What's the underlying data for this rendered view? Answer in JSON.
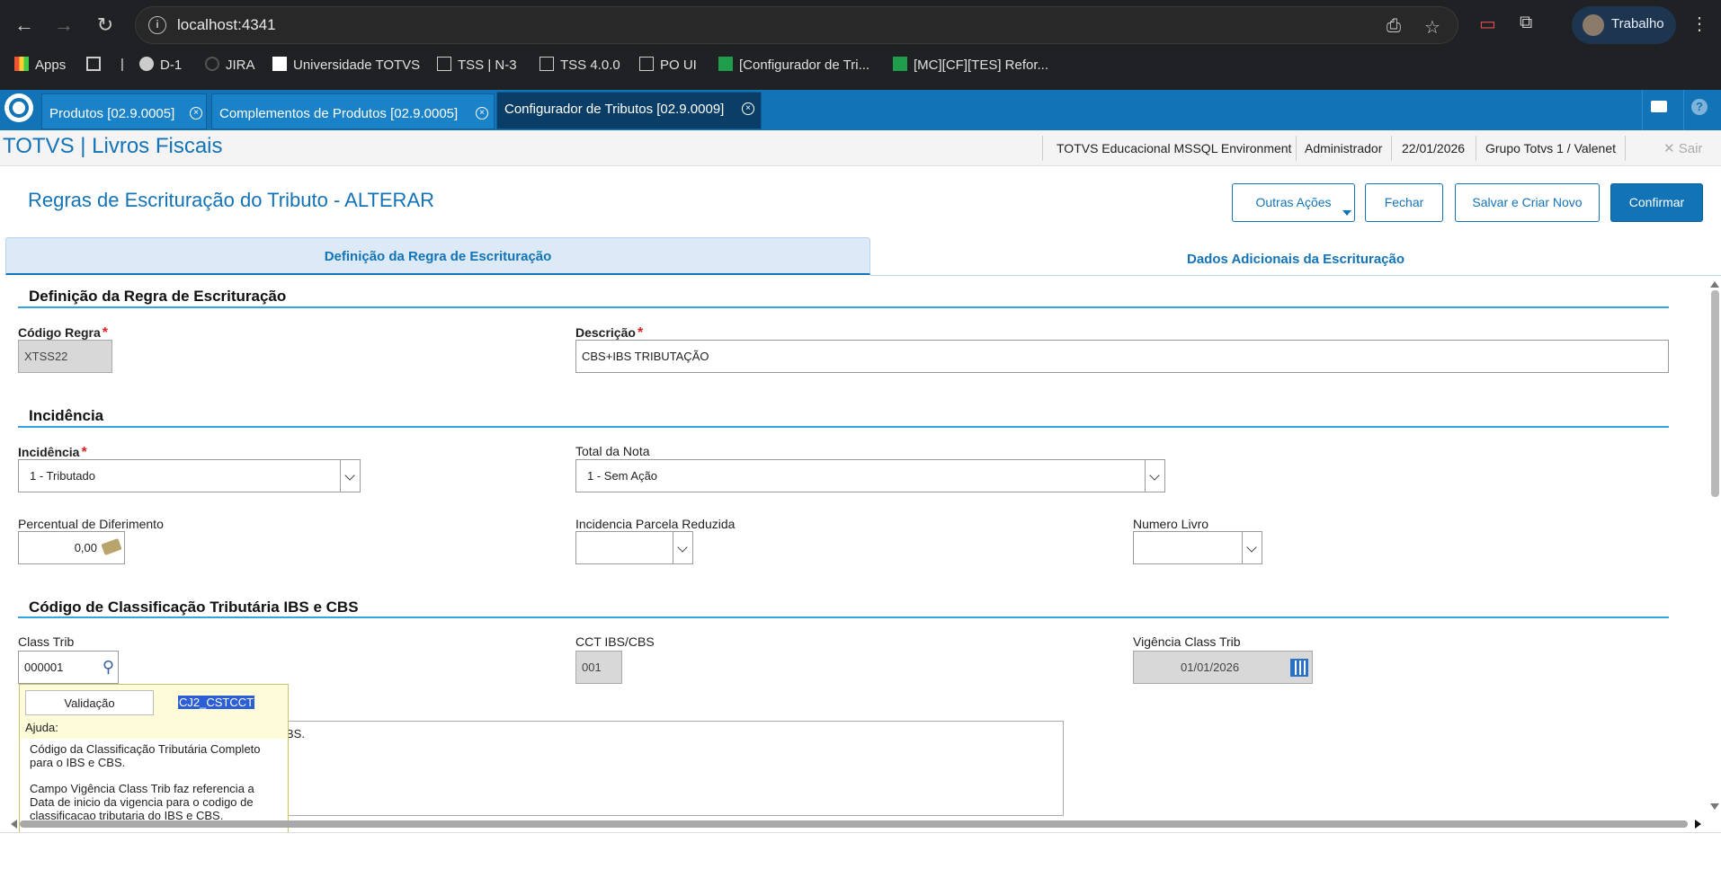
{
  "browser": {
    "url": "localhost:4341",
    "profile_name": "Trabalho",
    "bookmarks": [
      {
        "label": "Apps"
      },
      {
        "label": "D-1"
      },
      {
        "label": "JIRA"
      },
      {
        "label": "Universidade TOTVS"
      },
      {
        "label": "TSS | N-3"
      },
      {
        "label": "TSS 4.0.0"
      },
      {
        "label": "PO UI"
      },
      {
        "label": "[Configurador de Tri..."
      },
      {
        "label": "[MC][CF][TES] Refor..."
      }
    ]
  },
  "app_tabs": [
    {
      "label": "Produtos [02.9.0005]"
    },
    {
      "label": "Complementos de Produtos [02.9.0005]"
    },
    {
      "label": "Configurador de Tributos [02.9.0009]"
    }
  ],
  "header": {
    "app_title": "TOTVS | Livros Fiscais",
    "environment": "TOTVS Educacional MSSQL Environment",
    "user": "Administrador",
    "date": "22/01/2026",
    "company": "Grupo Totvs 1 / Valenet",
    "logout": "Sair"
  },
  "page": {
    "title": "Regras de Escrituração do Tributo - ALTERAR",
    "buttons": {
      "outras_acoes": "Outras Ações",
      "fechar": "Fechar",
      "salvar_criar": "Salvar e Criar Novo",
      "confirmar": "Confirmar"
    },
    "tabs": [
      "Definição da Regra de Escrituração",
      "Dados Adicionais da Escrituração"
    ]
  },
  "sections": {
    "definicao": {
      "title": "Definição da Regra de Escrituração",
      "codigo_regra": {
        "label": "Código Regra",
        "value": "XTSS22"
      },
      "descricao": {
        "label": "Descrição",
        "value": "CBS+IBS TRIBUTAÇÃO"
      }
    },
    "incidencia": {
      "title": "Incidência",
      "incidencia": {
        "label": "Incidência",
        "value": "1 - Tributado"
      },
      "total_nota": {
        "label": "Total da Nota",
        "value": "1 - Sem Ação"
      },
      "percentual": {
        "label": "Percentual de Diferimento",
        "value": "0,00"
      },
      "parcela_reduzida": {
        "label": "Incidencia Parcela Reduzida",
        "value": ""
      },
      "numero_livro": {
        "label": "Numero Livro",
        "value": ""
      }
    },
    "classificacao": {
      "title": "Código de Classificação Tributária IBS e CBS",
      "class_trib": {
        "label": "Class Trib",
        "value": "000001"
      },
      "cct": {
        "label": "CCT IBS/CBS",
        "value": "001"
      },
      "vigencia": {
        "label": "Vigência Class Trib",
        "value": "01/01/2026"
      },
      "textarea_visible": "BS."
    }
  },
  "help_popup": {
    "tab_label": "Validação",
    "field_code": "CJ2_CSTCCT",
    "ajuda_label": "Ajuda:",
    "paragraph1": "Código da Classificação Tributária Completo para o IBS e CBS.",
    "paragraph2": "Campo Vigência Class Trib faz referencia a Data de inicio da vigencia para o codigo de classificacao tributaria do IBS e CBS."
  },
  "colors": {
    "brand_blue": "#1373b7",
    "section_line": "#35a3e0",
    "required_star": "#e02020",
    "popup_bg": "#fdfbd8"
  }
}
